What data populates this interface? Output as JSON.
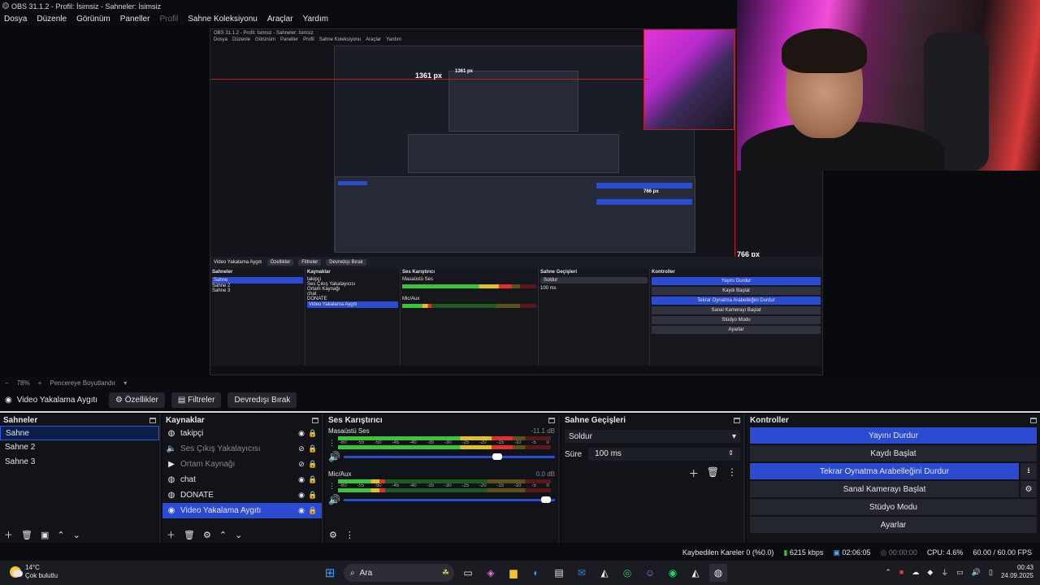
{
  "window": {
    "title": "OBS 31.1.2 - Profil: İsimsiz - Sahneler: İsimsiz"
  },
  "menu": [
    "Dosya",
    "Düzenle",
    "Görünüm",
    "Paneller",
    "Profil",
    "Sahne Koleksiyonu",
    "Araçlar",
    "Yardım"
  ],
  "preview": {
    "nested_title": "OBS 31.1.2 - Profil: İsimsiz - Sahneler: İsimsiz",
    "label_h": "1361 px",
    "label_h2": "1361 px",
    "label_v": "766 px",
    "label_v2": "766 px"
  },
  "zoom": {
    "minus": "−",
    "value": "78%",
    "plus": "+",
    "fit_label": "Pencereye Boyutlandır"
  },
  "source_toolbar": {
    "source_name": "Video Yakalama Aygıtı",
    "properties": "Özellikler",
    "filters": "Filtreler",
    "deactivate": "Devredışı Bırak"
  },
  "scenes": {
    "title": "Sahneler",
    "items": [
      "Sahne",
      "Sahne 2",
      "Sahne 3"
    ]
  },
  "sources": {
    "title": "Kaynaklar",
    "items": [
      {
        "icon": "globe-icon",
        "label": "takipçi",
        "visible": true
      },
      {
        "icon": "speaker-icon",
        "label": "Ses Çıkış Yakalayıcısı",
        "visible": false
      },
      {
        "icon": "play-icon",
        "label": "Ortam Kaynağı",
        "visible": false
      },
      {
        "icon": "globe-icon",
        "label": "chat",
        "visible": true
      },
      {
        "icon": "globe-icon",
        "label": "DONATE",
        "visible": true
      },
      {
        "icon": "camera-icon",
        "label": "Video Yakalama Aygıtı",
        "visible": true
      }
    ]
  },
  "mixer": {
    "title": "Ses Karıştırıcı",
    "ticks": [
      "-60",
      "-55",
      "-50",
      "-45",
      "-40",
      "-35",
      "-30",
      "-25",
      "-20",
      "-15",
      "-10",
      "-5",
      "0"
    ],
    "channels": [
      {
        "name": "Masaüstü Ses",
        "db": "-11.1 dB",
        "level": 0.82,
        "volume": 0.75
      },
      {
        "name": "Mic/Aux",
        "db": "0.0 dB",
        "level": 0.22,
        "volume": 0.98
      }
    ]
  },
  "transitions": {
    "title": "Sahne Geçişleri",
    "selected": "Soldur",
    "duration_label": "Süre",
    "duration_value": "100 ms"
  },
  "controls": {
    "title": "Kontroller",
    "stop_stream": "Yayını Durdur",
    "start_record": "Kaydı Başlat",
    "stop_replay": "Tekrar Oynatma Arabelleğini Durdur",
    "start_vcam": "Sanal Kamerayı Başlat",
    "studio_mode": "Stüdyo Modu",
    "settings": "Ayarlar"
  },
  "status": {
    "dropped": "Kaybedilen Kareler 0 (%0.0)",
    "bitrate": "6215 kbps",
    "stream_time": "02:06:05",
    "record_time": "00:00:00",
    "cpu": "CPU: 4.6%",
    "fps": "60.00 / 60.00 FPS"
  },
  "taskbar": {
    "temp": "14°C",
    "weather": "Çok bulutlu",
    "search_placeholder": "Ara",
    "time": "00:43",
    "date": "24.09.2025"
  },
  "colors": {
    "accent": "#2b4bd2",
    "bg": "#121318",
    "red_guide": "#c0192a"
  }
}
